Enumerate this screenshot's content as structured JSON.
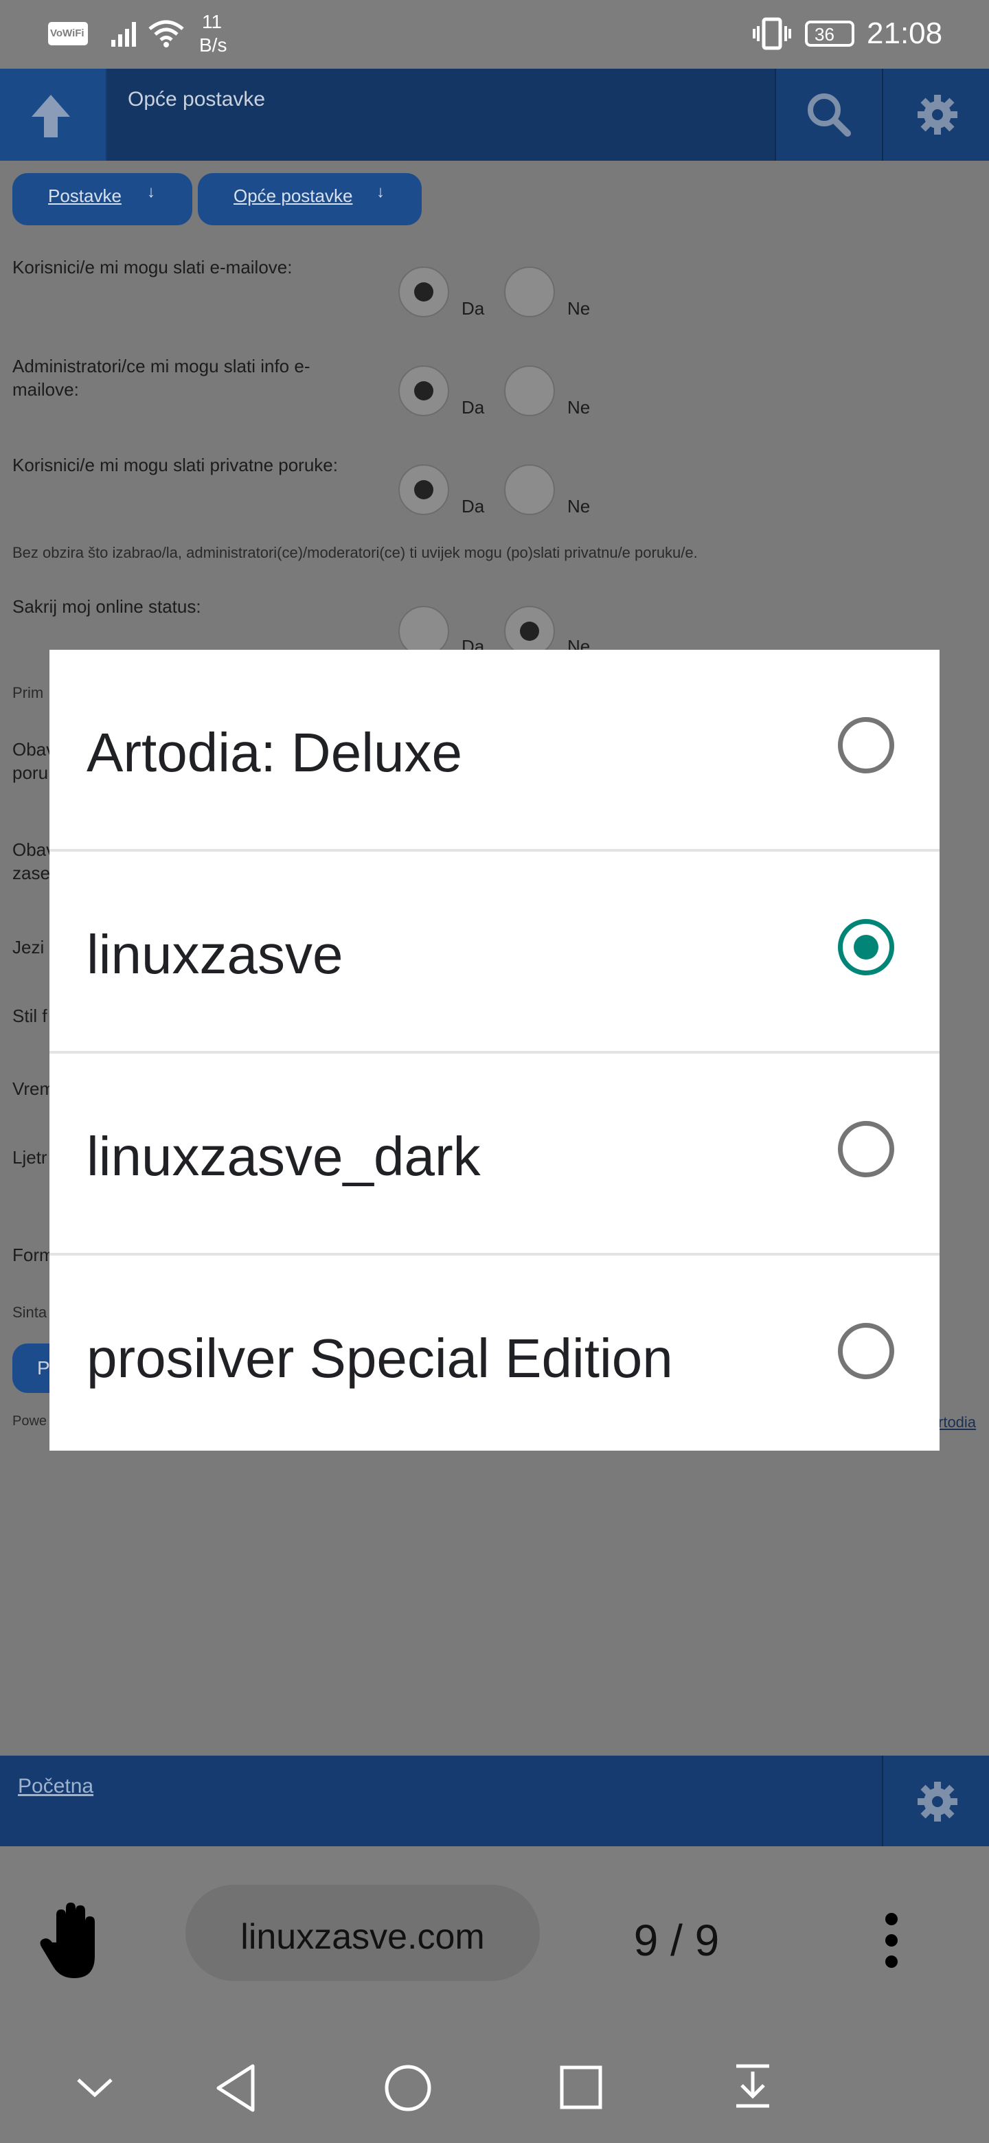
{
  "status_bar": {
    "wifi_badge": "VoWiFi",
    "net_speed_value": "11",
    "net_speed_unit": "B/s",
    "battery": "36",
    "time": "21:08"
  },
  "header": {
    "title": "Opće postavke"
  },
  "breadcrumbs": [
    {
      "label": "Postavke",
      "arrow": "↓"
    },
    {
      "label": "Opće postavke",
      "arrow": "↓"
    }
  ],
  "settings": {
    "rows": [
      {
        "label": "Korisnici/e mi mogu slati e-mailove:",
        "yes": "Da",
        "no": "Ne",
        "selected": "Da"
      },
      {
        "label": "Administratori/ce mi mogu slati info e-mailove:",
        "yes": "Da",
        "no": "Ne",
        "selected": "Da"
      },
      {
        "label": "Korisnici/e mi mogu slati privatne poruke:",
        "yes": "Da",
        "no": "Ne",
        "selected": "Da"
      }
    ],
    "note": "Bez obzira što izabrao/la, administratori(ce)/moderatori(ce) ti uvijek mogu (po)slati privatnu/e poruku/e.",
    "online_status": {
      "label": "Sakrij moj online status:",
      "yes": "Da",
      "no": "Ne",
      "selected": "Ne"
    },
    "partial_labels": [
      "Prim",
      "Obav",
      "poru",
      "Obav",
      "zase",
      "Jezi",
      "Stil f",
      "Vrem",
      "Ljetr",
      "Form",
      "Sinta",
      "P",
      "Powe"
    ],
    "right_link": "rtodia"
  },
  "theme_dialog": {
    "options": [
      {
        "label": "Artodia: Deluxe",
        "selected": false
      },
      {
        "label": "linuxzasve",
        "selected": true
      },
      {
        "label": "linuxzasve_dark",
        "selected": false
      },
      {
        "label": "prosilver Special Edition",
        "selected": false
      }
    ],
    "accent_color": "#008577"
  },
  "footer": {
    "home_link": "Početna"
  },
  "browser": {
    "url": "linuxzasve.com",
    "page_counter": "9 / 9"
  },
  "icons": {
    "up": "arrow-up-icon",
    "search": "search-icon",
    "settings": "gear-icon",
    "hand": "hand-icon",
    "menu": "more-vert-icon"
  }
}
